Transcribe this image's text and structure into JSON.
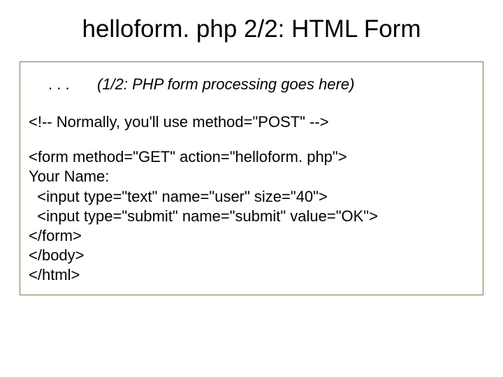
{
  "title": "helloform. php 2/2: HTML Form",
  "row1": {
    "ellipsis": ". . .",
    "note": "(1/2: PHP form processing goes here)"
  },
  "comment": "<!-- Normally, you'll use method=\"POST\" -->",
  "code": {
    "l1": "<form method=\"GET\" action=\"helloform. php\">",
    "l2": "Your Name:",
    "l3": "  <input type=\"text\" name=\"user\" size=\"40\">",
    "l4": "  <input type=\"submit\" name=\"submit\" value=\"OK\">",
    "l5": "</form>",
    "l6": "</body>",
    "l7": "</html>"
  }
}
